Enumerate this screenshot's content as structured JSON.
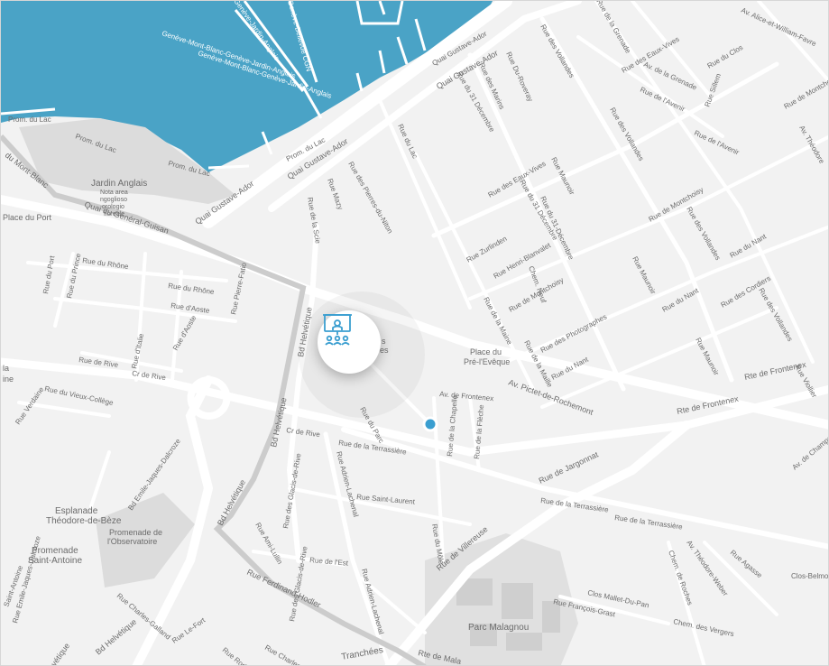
{
  "colors": {
    "water": "#4aa3c6",
    "land": "#f2f2f2",
    "road": "#ffffff",
    "park": "#dcdcdc",
    "route": "#cfcfcf",
    "pin": "#3a9ed0"
  },
  "water_labels": [
    "Genève-Mont-Blanc-Genève-Jardin-Anglais",
    "Genève-Mont-Blanc-Genève-Jardin-Anglais",
    "Genève-Jardin-Anglais",
    "Genève-Bellevue CGN"
  ],
  "streets": {
    "prom_lac_1": "Prom. du Lac",
    "prom_lac_2": "Prom. du Lac",
    "prom_lac_3": "Prom. du Lac",
    "prom_lac_4": "Prom. du Lac",
    "quai_ador_1": "Quai Gustave-Ador",
    "quai_ador_2": "Quai Gustave-Ador",
    "quai_ador_3": "Quai Gustave-Ador",
    "quai_ador_4": "Quai Gustave-Ador",
    "quai_guisan": "Quai du Général-Guisan",
    "mont_blanc": "du Mont-Blanc",
    "place_port": "Place du Port",
    "jardin_anglais": "Jardin Anglais",
    "nota_1": "Nota area",
    "nota_2": "ngoglioso",
    "nota_3": "orologio",
    "nota_4": "floreale",
    "rue_rhone_1": "Rue du Rhône",
    "rue_rhone_2": "Rue du Rhône",
    "rue_port": "Rue du Port",
    "rue_prince": "Rue du Prince",
    "rue_aoste_1": "Rue d'Aoste",
    "rue_aoste_2": "Rue d'Aoste",
    "pierre_fatio": "Rue Pierre-Fatio",
    "rue_italie": "Rue d'Italie",
    "rue_rive": "Rue de Rive",
    "cr_rive_1": "Cr de Rive",
    "cr_rive_2": "Cr de Rive",
    "vieux_college": "Rue du Vieux-Collège",
    "verdaine": "Rue Verdaine",
    "bd_helvetique_1": "Bd Helvétique",
    "bd_helvetique_2": "Bd Helvétique",
    "bd_helvetique_3": "Bd Helvétique",
    "bd_helvetique_4": "Bd Helvétique",
    "la": "la",
    "ine": "ine",
    "emile_dalcroze_1": "Bd Emile-Jaques-Dalcroze",
    "emile_dalcroze_2": "Rue Emile-Jaques-Dalcroze",
    "esplanade_1": "Esplanade",
    "esplanade_2": "Théodore-de-Bèze",
    "promenade_obs_1": "Promenade de",
    "promenade_obs_2": "l'Observatoire",
    "promenade_sa_1": "Promenade",
    "promenade_sa_2": "Saint-Antoine",
    "st_antoine": "Saint-Antoine",
    "charles_galland": "Rue Charles-Galland",
    "ferdinand_hodler": "Rue Ferdinand-Hodler",
    "rue_est": "Rue de l'Est",
    "ami_lullin": "Rue Ami-Lullin",
    "glacis_rive_1": "Rue des Glacis-de-Rive",
    "glacis_rive_2": "Rue des Glacis-de-Rive",
    "adrien_lachenal_1": "Rue Adrien-Lachenal",
    "adrien_lachenal_2": "Rue Adrien-Lachenal",
    "saint_laurent": "Rue Saint-Laurent",
    "terrassiere_1": "Rue de la Terrassière",
    "terrassiere_2": "Rue de la Terrassière",
    "terrassiere_3": "Rue de la Terrassière",
    "rue_parc": "Rue du Parc",
    "rue_mole": "Rue du Môle",
    "rue_chapelle": "Rue de la Chapelle",
    "rue_fleche": "Rue de la Flèche",
    "frontenex_1": "Av. de Frontenex",
    "frontenex_2": "Rte de Frontenex",
    "frontenex_3": "Rte de Frontenex",
    "pictet": "Av. Pictet-de-Rochemont",
    "jargonnat": "Rue de Jargonnat",
    "villereuse": "Rue de Villereuse",
    "place_pre_1": "Place du",
    "place_pre_2": "Pré-l'Evêque",
    "rue_scie": "Rue de la Scie",
    "rue_mazy": "Rue Mazy",
    "pierres_niton": "Rue des Pierres-du-Niton",
    "rue_lac": "Rue du Lac",
    "eaux_vives_1": "Rue des Eaux-Vives",
    "eaux_vives_2": "Rue des Eaux-Vives",
    "trente_dec_1": "Rue du 31 Décembre",
    "trente_dec_2": "Rue du 31 Décembre",
    "trente_dec_3": "Rue du 31-Décembre",
    "du_roveray": "Rue Du-Roveray",
    "marin": "Rue des Marins",
    "zurlinden": "Rue Zurlinden",
    "henri_blanvalet": "Rue Henri-Blanvalet",
    "chem_neuf": "Chem. Neuf",
    "rue_maison": "Rue de la Maine",
    "montchoisy_1": "Rue de Montchoisy",
    "montchoisy_2": "Rue de Montchoisy",
    "photographes": "Rue des Photographes",
    "rue_maraiche": "Rue de la Maille",
    "rue_nant_1": "Rue du Nant",
    "rue_nant_2": "Rue du Nant",
    "rue_nant_3": "Rue du Nant",
    "vollandes_1": "Rue des Vollandes",
    "vollandes_2": "Rue des Vollandes",
    "vollandes_3": "Rue des Vollandes",
    "vollandes_4": "Rue des Vollandes",
    "maunoir_1": "Rue Maunoir",
    "maunoir_2": "Rue Maunoir",
    "maunoir_3": "Rue Maunoir",
    "cordiers": "Rue des Cordiers",
    "rue_clos": "Rue du Clos",
    "sillem": "Rue Sillem",
    "grenade_1": "Rue de la Grenade",
    "grenade_2": "Av. de la Grenade",
    "eaux_vives_3": "Rue des Eaux-Vives",
    "avenir_1": "Rue de l'Avenir",
    "avenir_2": "Rue de l'Avenir",
    "william_favre": "Av. Alice-et-William-Favre",
    "montchoisy_3": "Rue de Montchoisy",
    "av_theodore": "Av. Théodore",
    "viollier": "Rue Viollier",
    "chemin_roches": "Chem. de Roches",
    "chem_vergers": "Chem. des Vergers",
    "theo_weber": "Av. Théodore-Weber",
    "agasse": "Rue Agasse",
    "clos_belmont": "Clos-Belmont",
    "mallet_du_pan": "Clos Mallet-Du-Pan",
    "francois_grast": "Rue François-Grast",
    "parc_malagnou": "Parc Malagnou",
    "rte_malagnou": "Rte de Mala",
    "tranchees": "Tranchées",
    "rue_fort": "Rue Le-Fort",
    "rodolphe": "Rue Rodolphe",
    "rue_charles": "Rue Charles",
    "bd_helvetique_5": "Bd Helvétique",
    "vetique": "vétique",
    "champel": "Av. de Champel",
    "av_de": "Av. de",
    "rue_mo": "Rue Mo...",
    "bronze_1": "s",
    "bronze_2": "es"
  },
  "marker": {
    "icon": "stage-presenter-icon",
    "pin": "location-pin"
  }
}
